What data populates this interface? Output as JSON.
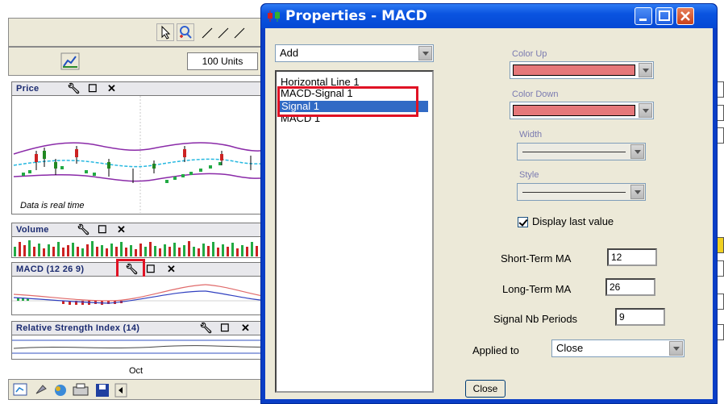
{
  "app": {
    "units_label": "100 Units",
    "panels": {
      "price": {
        "title": "Price",
        "note": "Data is real time"
      },
      "volume": {
        "title": "Volume"
      },
      "macd": {
        "title": "MACD (12 26 9)"
      },
      "rsi": {
        "title": "Relative Strength Index (14)"
      }
    },
    "x_axis_label": "Oct",
    "icons": [
      "pointer-icon",
      "zoom-icon",
      "line-tool-icon",
      "chart-icon",
      "wrench-icon",
      "maximize-icon",
      "close-icon"
    ]
  },
  "dialog": {
    "title": "Properties - MACD",
    "add_select": "Add",
    "list_items": [
      "Horizontal Line 1",
      "MACD-Signal 1",
      "Signal 1",
      "MACD 1"
    ],
    "selected_index": 2,
    "color_up_label": "Color Up",
    "color_down_label": "Color Down",
    "width_label": "Width",
    "style_label": "Style",
    "display_last_value_label": "Display last value",
    "display_last_value_checked": true,
    "short_term_label": "Short-Term MA",
    "short_term_value": "12",
    "long_term_label": "Long-Term MA",
    "long_term_value": "26",
    "signal_label": "Signal Nb Periods",
    "signal_value": "9",
    "applied_to_label": "Applied to",
    "applied_to_value": "Close",
    "close_button": "Close",
    "colors": {
      "color_up": "#e5787a",
      "color_down": "#e5787a",
      "highlight": "#e01224",
      "title_bar": "#0a54e0"
    }
  }
}
